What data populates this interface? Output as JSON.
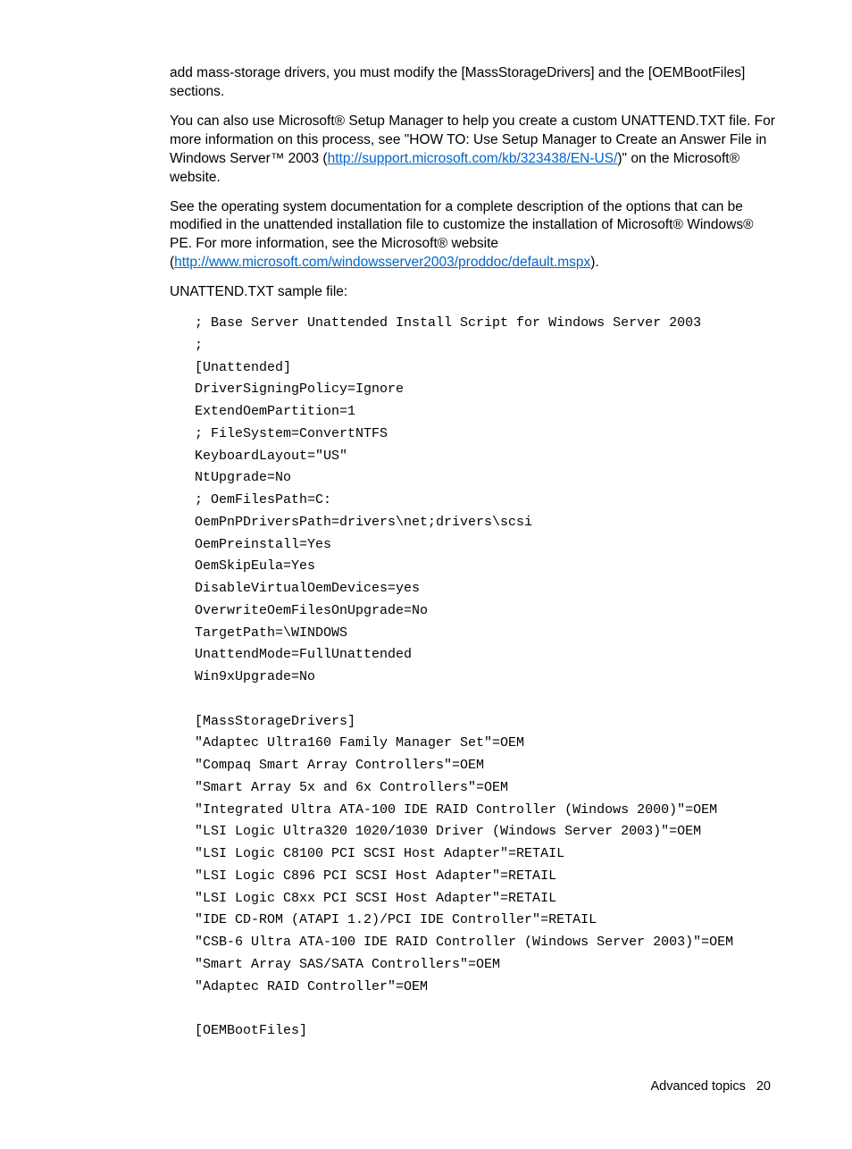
{
  "para1": "add mass-storage drivers, you must modify the [MassStorageDrivers] and the [OEMBootFiles] sections.",
  "para2_pre": "You can also use Microsoft® Setup Manager to help you create a custom UNATTEND.TXT file. For more information on this process, see \"HOW TO: Use Setup Manager to Create an Answer File in Windows Server™ 2003 (",
  "para2_link": "http://support.microsoft.com/kb/323438/EN-US/",
  "para2_post": ")\" on the Microsoft® website.",
  "para3_pre": "See the operating system documentation for a complete description of the options that can be modified in the unattended installation file to customize the installation of Microsoft® Windows® PE. For more information, see the Microsoft® website (",
  "para3_link": "http://www.microsoft.com/windowsserver2003/proddoc/default.mspx",
  "para3_post": ").",
  "para4": "UNATTEND.TXT sample file:",
  "code": "; Base Server Unattended Install Script for Windows Server 2003\n;\n[Unattended]\nDriverSigningPolicy=Ignore\nExtendOemPartition=1\n; FileSystem=ConvertNTFS\nKeyboardLayout=\"US\"\nNtUpgrade=No\n; OemFilesPath=C:\nOemPnPDriversPath=drivers\\net;drivers\\scsi\nOemPreinstall=Yes\nOemSkipEula=Yes\nDisableVirtualOemDevices=yes\nOverwriteOemFilesOnUpgrade=No\nTargetPath=\\WINDOWS\nUnattendMode=FullUnattended\nWin9xUpgrade=No\n\n[MassStorageDrivers]\n\"Adaptec Ultra160 Family Manager Set\"=OEM\n\"Compaq Smart Array Controllers\"=OEM\n\"Smart Array 5x and 6x Controllers\"=OEM\n\"Integrated Ultra ATA-100 IDE RAID Controller (Windows 2000)\"=OEM\n\"LSI Logic Ultra320 1020/1030 Driver (Windows Server 2003)\"=OEM\n\"LSI Logic C8100 PCI SCSI Host Adapter\"=RETAIL\n\"LSI Logic C896 PCI SCSI Host Adapter\"=RETAIL\n\"LSI Logic C8xx PCI SCSI Host Adapter\"=RETAIL\n\"IDE CD-ROM (ATAPI 1.2)/PCI IDE Controller\"=RETAIL\n\"CSB-6 Ultra ATA-100 IDE RAID Controller (Windows Server 2003)\"=OEM\n\"Smart Array SAS/SATA Controllers\"=OEM\n\"Adaptec RAID Controller\"=OEM\n\n[OEMBootFiles]",
  "footer_text": "Advanced topics",
  "footer_page": "20"
}
